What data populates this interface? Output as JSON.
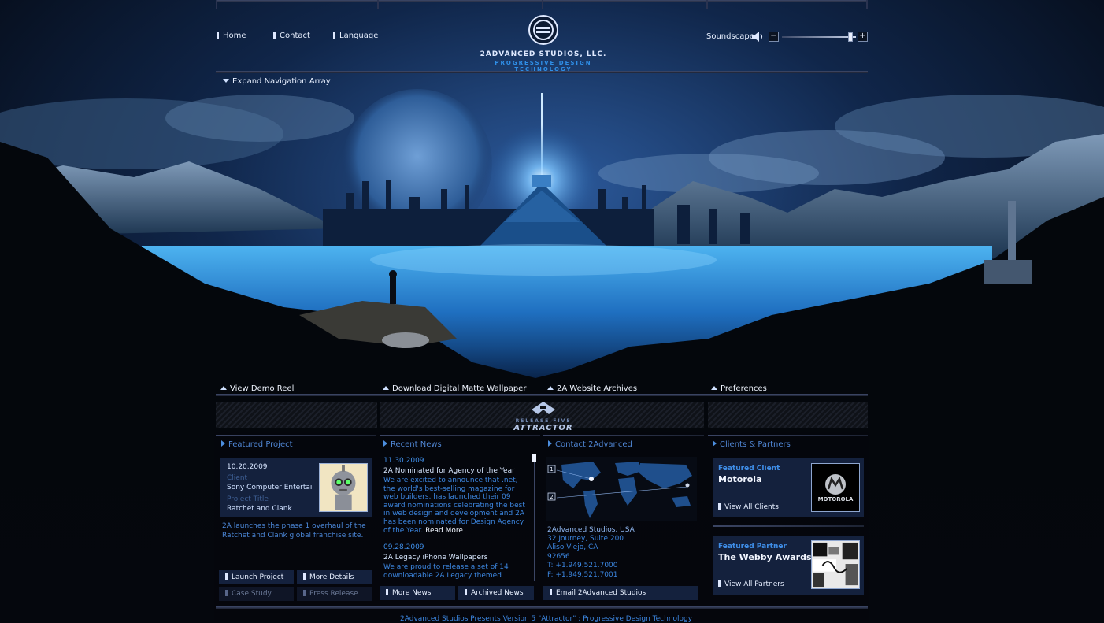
{
  "nav": {
    "home": "Home",
    "contact": "Contact",
    "language": "Language",
    "expand": "Expand Navigation Array"
  },
  "logo": {
    "name": "2ADVANCED STUDIOS, LLC.",
    "tagline": "PROGRESSIVE DESIGN TECHNOLOGY"
  },
  "sound": {
    "label": "Soundscape",
    "minus": "−",
    "plus": "+",
    "volume_fraction": 0.93
  },
  "tabs": {
    "demo": "View Demo Reel",
    "wallpaper": "Download Digital Matte Wallpaper",
    "archives": "2A Website Archives",
    "preferences": "Preferences"
  },
  "release": {
    "subtitle": "RELEASE FIVE",
    "name": "ATTRACTOR"
  },
  "featured_project": {
    "header": "Featured Project",
    "date": "10.20.2009",
    "client_label": "Client",
    "client": "Sony Computer Entertainment",
    "title_label": "Project Title",
    "title": "Ratchet and Clank",
    "description": "2A launches the phase 1 overhaul of the Ratchet and Clank global franchise site.",
    "launch": "Launch Project",
    "details": "More Details",
    "case_study": "Case Study",
    "press": "Press Release"
  },
  "news": {
    "header": "Recent News",
    "items": [
      {
        "date": "11.30.2009",
        "title": "2A Nominated for Agency of the Year",
        "body": "We are excited to announce that .net, the world's best-selling magazine for web builders, has launched their 09 award nominations celebrating the best in web design and development and 2A has been nominated for Design Agency of the Year.",
        "more": "Read More"
      },
      {
        "date": "09.28.2009",
        "title": "2A Legacy iPhone Wallpapers",
        "body": "We are proud to release a set of 14 downloadable 2A Legacy themed"
      }
    ],
    "more_news": "More News",
    "archived": "Archived News"
  },
  "contact": {
    "header": "Contact 2Advanced",
    "company": "2Advanced Studios, USA",
    "street": "32 Journey, Suite 200",
    "city": "Aliso Viejo, CA",
    "zip": "92656",
    "phone": "T:  +1.949.521.7000",
    "fax": "F:  +1.949.521.7001",
    "email": "Email 2Advanced Studios",
    "map_marker_1": "1",
    "map_marker_2": "2"
  },
  "clients": {
    "header": "Clients & Partners",
    "client_label": "Featured Client",
    "client_name": "Motorola",
    "view_clients": "View All Clients",
    "client_logo_text": "MOTOROLA",
    "partner_label": "Featured Partner",
    "partner_name": "The Webby Awards",
    "view_partners": "View All Partners"
  },
  "footer": {
    "text": "2Advanced Studios Presents Version 5 \"Attractor\" : Progressive Design Technology"
  },
  "colors": {
    "accent": "#3f8ee8",
    "panel": "#14213d",
    "background": "#05070d"
  }
}
